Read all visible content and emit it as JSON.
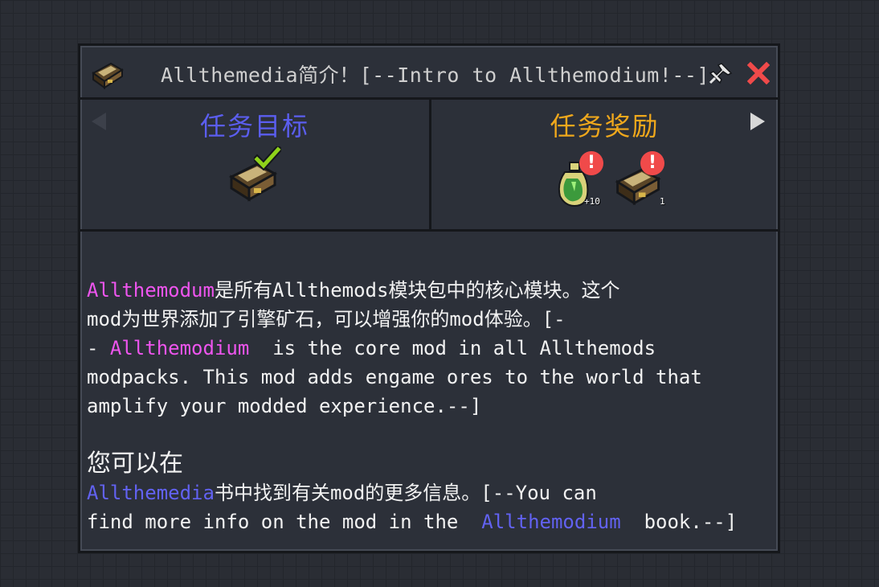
{
  "window": {
    "title": "Allthemedia简介！[--Intro to Allthemodium!--]"
  },
  "tasks": {
    "heading": "任务目标"
  },
  "rewards": {
    "heading": "任务奖励",
    "items": [
      {
        "icon": "experience-bottle-icon",
        "count": "+10"
      },
      {
        "icon": "book-icon",
        "count": "1"
      }
    ]
  },
  "description": {
    "lines": [
      [
        {
          "text": "Allthemodum",
          "color": "magenta"
        },
        {
          "text": "是所有Allthemods模块包中的核心模块。这个"
        }
      ],
      [
        {
          "text": "mod为世界添加了引擎矿石，可以增强你的mod体验。[-"
        }
      ],
      [
        {
          "text": "- "
        },
        {
          "text": "Allthemodium",
          "color": "magenta"
        },
        {
          "text": "  is the core mod in all Allthemods"
        }
      ],
      [
        {
          "text": "modpacks. This mod adds engame ores to the world that"
        }
      ],
      [
        {
          "text": "amplify your modded experience.--]"
        }
      ],
      [
        {
          "text": ""
        }
      ],
      [
        {
          "text": "您可以在"
        }
      ],
      [
        {
          "text": "Allthemedia",
          "color": "blue"
        },
        {
          "text": "书中找到有关mod的更多信息。[--You can"
        }
      ],
      [
        {
          "text": "find more info on the mod in the  "
        },
        {
          "text": "Allthemodium",
          "color": "blue"
        },
        {
          "text": "  book.--]"
        }
      ]
    ]
  },
  "colors": {
    "task_heading": "#5b5ef0",
    "reward_heading": "#f0a81c",
    "highlight_magenta": "#ee55ee",
    "highlight_blue": "#6262f2",
    "close": "#f04a4a",
    "badge": "#f04a4a"
  }
}
